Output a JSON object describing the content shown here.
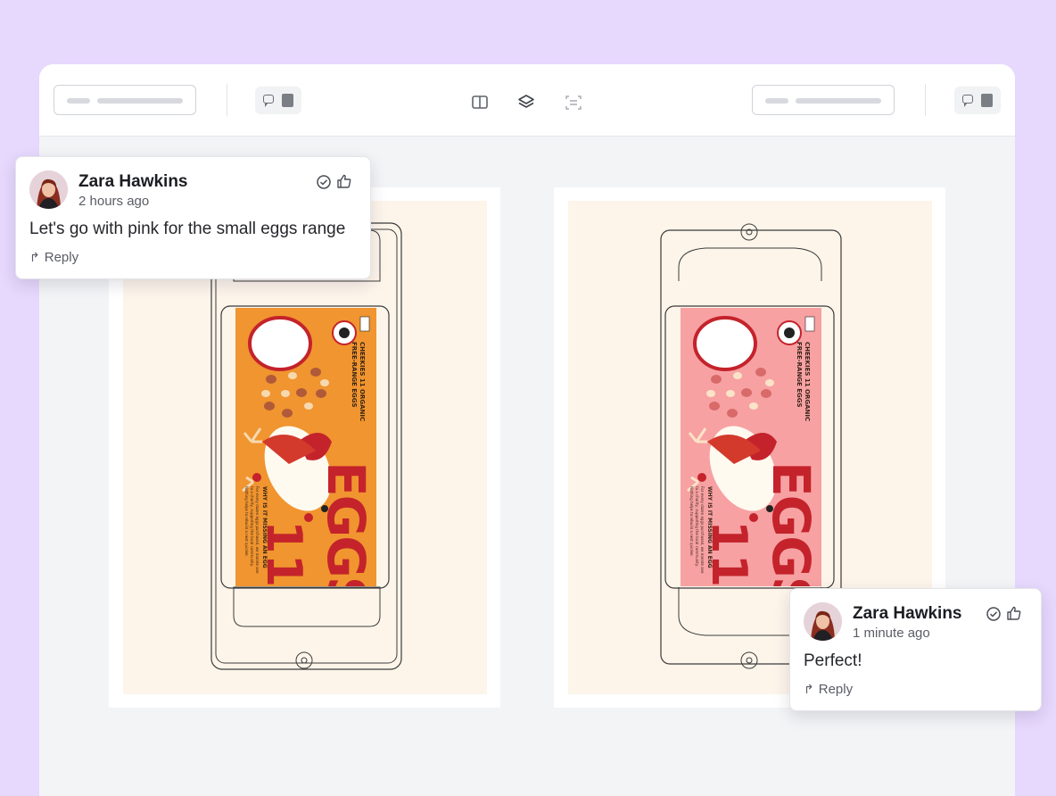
{
  "comments": [
    {
      "author": "Zara Hawkins",
      "time": "2 hours ago",
      "text": "Let's go with pink for the small eggs range",
      "reply_label": "Reply"
    },
    {
      "author": "Zara Hawkins",
      "time": "1 minute ago",
      "text": "Perfect!",
      "reply_label": "Reply"
    }
  ],
  "toolbar": {
    "left_comment_icon": "comment-icon",
    "center_tools": [
      "compare-icon",
      "layers-icon",
      "scan-icon"
    ],
    "right_comment_icon": "comment-icon"
  },
  "artwork": {
    "left_version": {
      "label_color": "#f0952f",
      "headline": "EGGS",
      "count": "11",
      "brand_line_1": "CHEEKIES 11 ORGANIC",
      "brand_line_2": "FREE-RANGE EGGS",
      "side_heading": "WHY IS IT MISSING AN EGG",
      "side_copy_1": "For every dozen eggs purchased, we donate one",
      "side_copy_2": "to a charity, supporting the local community.",
      "side_copy_3": "Nothing helps to rebuild a nest quicker."
    },
    "right_version": {
      "label_color": "#f7a1a3",
      "headline": "EGGS",
      "count": "11",
      "brand_line_1": "CHEEKIES 11 ORGANIC",
      "brand_line_2": "FREE-RANGE EGGS",
      "side_heading": "WHY IS IT MISSING AN EGG",
      "side_copy_1": "For every dozen eggs purchased, we donate one",
      "side_copy_2": "to a charity, supporting the local community.",
      "side_copy_3": "Nothing helps to rebuild a nest quicker."
    }
  },
  "colors": {
    "outer_background": "#e7d8fd",
    "canvas_background": "#fdf5ea",
    "headline_red": "#c4232b"
  }
}
